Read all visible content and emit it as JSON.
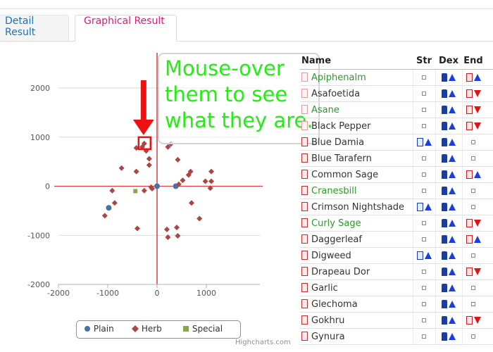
{
  "tabs": [
    {
      "label": "Detail Result",
      "active": false
    },
    {
      "label": "Graphical Result",
      "active": true
    }
  ],
  "callout": {
    "text": "Mouse-over\nthem to see\nwhat they are."
  },
  "table": {
    "headers": {
      "name": "Name",
      "str": "Str",
      "dex": "Dex",
      "end": "End"
    },
    "rows": [
      {
        "name": "Apiphenalm",
        "color": "green",
        "faded": true,
        "str": "dot",
        "dex": "up",
        "end": "up"
      },
      {
        "name": "Asafoetida",
        "color": "dark",
        "faded": true,
        "str": "dot",
        "dex": "up",
        "end": "down"
      },
      {
        "name": "Asane",
        "color": "green",
        "faded": true,
        "str": "dot",
        "dex": "up",
        "end": "down"
      },
      {
        "name": "Black Pepper",
        "color": "dark",
        "faded": true,
        "str": "dot",
        "dex": "up",
        "end": "down"
      },
      {
        "name": "Blue Damia",
        "color": "dark",
        "faded": false,
        "str": "up",
        "dex": "up",
        "end": "dot"
      },
      {
        "name": "Blue Tarafern",
        "color": "dark",
        "faded": false,
        "str": "dot",
        "dex": "up",
        "end": "dot"
      },
      {
        "name": "Common Sage",
        "color": "dark",
        "faded": false,
        "str": "dot",
        "dex": "up",
        "end": "up"
      },
      {
        "name": "Cranesbill",
        "color": "green",
        "faded": false,
        "str": "dot",
        "dex": "up",
        "end": "dot"
      },
      {
        "name": "Crimson Nightshade",
        "color": "dark",
        "faded": false,
        "str": "up",
        "dex": "up",
        "end": "dot"
      },
      {
        "name": "Curly Sage",
        "color": "green",
        "faded": false,
        "str": "dot",
        "dex": "up",
        "end": "down"
      },
      {
        "name": "Daggerleaf",
        "color": "dark",
        "faded": false,
        "str": "dot",
        "dex": "up",
        "end": "up"
      },
      {
        "name": "Digweed",
        "color": "dark",
        "faded": false,
        "str": "up",
        "dex": "up",
        "end": "dot"
      },
      {
        "name": "Drapeau Dor",
        "color": "dark",
        "faded": false,
        "str": "dot",
        "dex": "up",
        "end": "down"
      },
      {
        "name": "Garlic",
        "color": "dark",
        "faded": false,
        "str": "dot",
        "dex": "up",
        "end": "dot"
      },
      {
        "name": "Glechoma",
        "color": "dark",
        "faded": false,
        "str": "dot",
        "dex": "up",
        "end": "dot"
      },
      {
        "name": "Gokhru",
        "color": "dark",
        "faded": false,
        "str": "dot",
        "dex": "up",
        "end": "down"
      },
      {
        "name": "Gynura",
        "color": "dark",
        "faded": false,
        "str": "dot",
        "dex": "up",
        "end": "dot"
      }
    ]
  },
  "chart_data": {
    "type": "scatter",
    "xlim": [
      -2000,
      2000
    ],
    "ylim": [
      -2000,
      2000
    ],
    "x_ticks": [
      -2000,
      -1000,
      0,
      1000
    ],
    "y_ticks": [
      2000,
      1000,
      0,
      -1000,
      -2000
    ],
    "series": [
      {
        "name": "Plain",
        "marker": "circle",
        "color": "#4572a7",
        "points": [
          [
            0,
            0
          ],
          [
            380,
            0
          ],
          [
            -980,
            -440
          ]
        ]
      },
      {
        "name": "Herb",
        "marker": "diamond",
        "color": "#aa4643",
        "points": [
          [
            -300,
            800
          ],
          [
            -260,
            870
          ],
          [
            -220,
            720
          ],
          [
            -420,
            780
          ],
          [
            -160,
            560
          ],
          [
            -160,
            430
          ],
          [
            -720,
            370
          ],
          [
            -420,
            300
          ],
          [
            -910,
            -90
          ],
          [
            -860,
            -340
          ],
          [
            -1060,
            -600
          ],
          [
            -260,
            -90
          ],
          [
            -120,
            -20
          ],
          [
            -400,
            -860
          ],
          [
            -100,
            -50
          ],
          [
            220,
            800
          ],
          [
            280,
            860
          ],
          [
            420,
            540
          ],
          [
            680,
            300
          ],
          [
            980,
            100
          ],
          [
            1100,
            300
          ],
          [
            1100,
            100
          ],
          [
            520,
            120
          ],
          [
            440,
            40
          ],
          [
            640,
            230
          ],
          [
            700,
            -340
          ],
          [
            860,
            -660
          ],
          [
            200,
            -880
          ],
          [
            220,
            -1040
          ],
          [
            400,
            -840
          ],
          [
            420,
            -1010
          ],
          [
            1080,
            -40
          ]
        ]
      },
      {
        "name": "Special",
        "marker": "square",
        "color": "#89a54e",
        "points": [
          [
            -440,
            -100
          ]
        ]
      }
    ],
    "highlight_point": [
      -260,
      870
    ],
    "legend": [
      "Plain",
      "Herb",
      "Special"
    ],
    "grid": true,
    "credit": "Highcharts.com"
  }
}
